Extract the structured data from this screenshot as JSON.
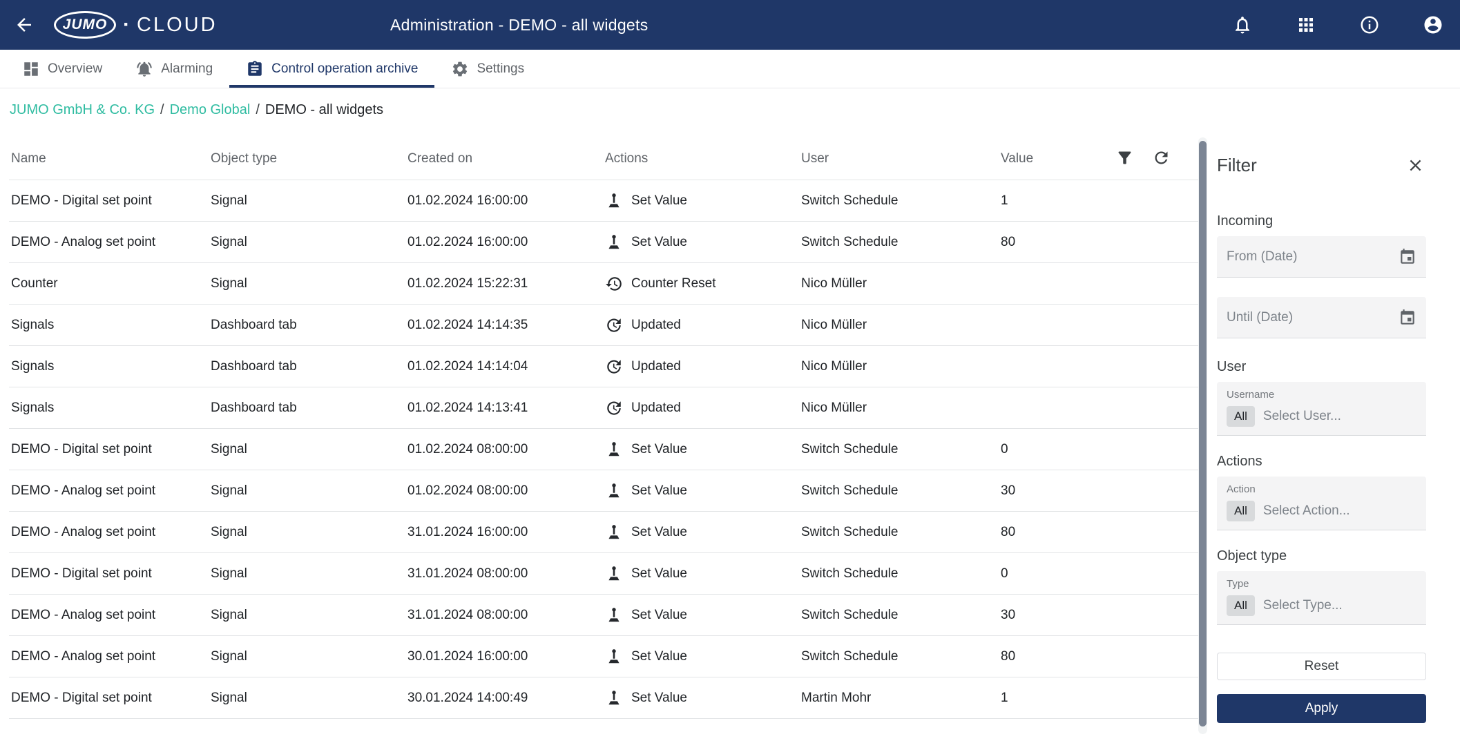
{
  "colors": {
    "primary": "#1f3768",
    "accent": "#2fbca1"
  },
  "topbar": {
    "title": "Administration - DEMO - all widgets",
    "logo_brand": "JUMO",
    "logo_separator": "·",
    "logo_product": "CLOUD"
  },
  "icons": {
    "back": "arrow-left",
    "notifications": "bell",
    "apps": "grid-3x3",
    "info": "info-circle",
    "account": "person-circle",
    "filter": "funnel",
    "refresh": "circular-arrow",
    "calendar": "calendar",
    "close": "x",
    "set_value": "control-lever",
    "counter_reset": "history-clock",
    "updated": "update-clock"
  },
  "tabs": [
    {
      "label": "Overview",
      "icon": "overview-grid",
      "active": false
    },
    {
      "label": "Alarming",
      "icon": "alarm-bell",
      "active": false
    },
    {
      "label": "Control operation archive",
      "icon": "archive-document",
      "active": true
    },
    {
      "label": "Settings",
      "icon": "settings-gear",
      "active": false
    }
  ],
  "breadcrumb": {
    "separator": "/",
    "items": [
      {
        "label": "JUMO GmbH & Co. KG",
        "link": true
      },
      {
        "label": "Demo Global",
        "link": true
      },
      {
        "label": "DEMO - all widgets",
        "link": false
      }
    ]
  },
  "table": {
    "columns": {
      "name": "Name",
      "object_type": "Object type",
      "created_on": "Created on",
      "actions": "Actions",
      "user": "User",
      "value": "Value"
    },
    "rows": [
      {
        "name": "DEMO - Digital set point",
        "object_type": "Signal",
        "created_on": "01.02.2024 16:00:00",
        "action": "Set Value",
        "action_icon": "set-value",
        "user": "Switch Schedule",
        "value": "1"
      },
      {
        "name": "DEMO - Analog set point",
        "object_type": "Signal",
        "created_on": "01.02.2024 16:00:00",
        "action": "Set Value",
        "action_icon": "set-value",
        "user": "Switch Schedule",
        "value": "80"
      },
      {
        "name": "Counter",
        "object_type": "Signal",
        "created_on": "01.02.2024 15:22:31",
        "action": "Counter Reset",
        "action_icon": "counter-reset",
        "user": "Nico Müller",
        "value": ""
      },
      {
        "name": "Signals",
        "object_type": "Dashboard tab",
        "created_on": "01.02.2024 14:14:35",
        "action": "Updated",
        "action_icon": "updated",
        "user": "Nico Müller",
        "value": ""
      },
      {
        "name": "Signals",
        "object_type": "Dashboard tab",
        "created_on": "01.02.2024 14:14:04",
        "action": "Updated",
        "action_icon": "updated",
        "user": "Nico Müller",
        "value": ""
      },
      {
        "name": "Signals",
        "object_type": "Dashboard tab",
        "created_on": "01.02.2024 14:13:41",
        "action": "Updated",
        "action_icon": "updated",
        "user": "Nico Müller",
        "value": ""
      },
      {
        "name": "DEMO - Digital set point",
        "object_type": "Signal",
        "created_on": "01.02.2024 08:00:00",
        "action": "Set Value",
        "action_icon": "set-value",
        "user": "Switch Schedule",
        "value": "0"
      },
      {
        "name": "DEMO - Analog set point",
        "object_type": "Signal",
        "created_on": "01.02.2024 08:00:00",
        "action": "Set Value",
        "action_icon": "set-value",
        "user": "Switch Schedule",
        "value": "30"
      },
      {
        "name": "DEMO - Analog set point",
        "object_type": "Signal",
        "created_on": "31.01.2024 16:00:00",
        "action": "Set Value",
        "action_icon": "set-value",
        "user": "Switch Schedule",
        "value": "80"
      },
      {
        "name": "DEMO - Digital set point",
        "object_type": "Signal",
        "created_on": "31.01.2024 08:00:00",
        "action": "Set Value",
        "action_icon": "set-value",
        "user": "Switch Schedule",
        "value": "0"
      },
      {
        "name": "DEMO - Analog set point",
        "object_type": "Signal",
        "created_on": "31.01.2024 08:00:00",
        "action": "Set Value",
        "action_icon": "set-value",
        "user": "Switch Schedule",
        "value": "30"
      },
      {
        "name": "DEMO - Analog set point",
        "object_type": "Signal",
        "created_on": "30.01.2024 16:00:00",
        "action": "Set Value",
        "action_icon": "set-value",
        "user": "Switch Schedule",
        "value": "80"
      },
      {
        "name": "DEMO - Digital set point",
        "object_type": "Signal",
        "created_on": "30.01.2024 14:00:49",
        "action": "Set Value",
        "action_icon": "set-value",
        "user": "Martin Mohr",
        "value": "1"
      }
    ]
  },
  "filter_panel": {
    "title": "Filter",
    "incoming": {
      "heading": "Incoming",
      "from_placeholder": "From (Date)",
      "until_placeholder": "Until (Date)"
    },
    "user": {
      "heading": "User",
      "field_label": "Username",
      "chip": "All",
      "placeholder": "Select User..."
    },
    "actions": {
      "heading": "Actions",
      "field_label": "Action",
      "chip": "All",
      "placeholder": "Select Action..."
    },
    "object_type": {
      "heading": "Object type",
      "field_label": "Type",
      "chip": "All",
      "placeholder": "Select Type..."
    },
    "reset_label": "Reset",
    "apply_label": "Apply"
  }
}
